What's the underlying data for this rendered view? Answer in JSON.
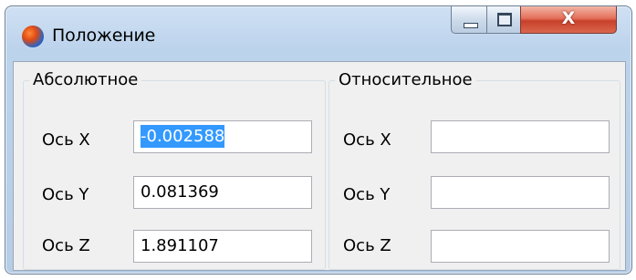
{
  "window": {
    "title": "Положение",
    "close_glyph": "X"
  },
  "absolute": {
    "group_title": "Абсолютное",
    "rows": [
      {
        "label": "Ось X",
        "value": "-0.002588",
        "selected": true
      },
      {
        "label": "Ось Y",
        "value": "0.081369"
      },
      {
        "label": "Ось Z",
        "value": "1.891107"
      }
    ]
  },
  "relative": {
    "group_title": "Относительное",
    "rows": [
      {
        "label": "Ось X",
        "value": ""
      },
      {
        "label": "Ось Y",
        "value": ""
      },
      {
        "label": "Ось Z",
        "value": ""
      }
    ]
  },
  "icons": {
    "app": "app-globe-icon",
    "minimize": "minimize-icon",
    "maximize": "maximize-icon",
    "close": "close-icon"
  },
  "colors": {
    "selection": "#3399ff",
    "close_button": "#d9674d",
    "frame": "#bcd3ec"
  }
}
